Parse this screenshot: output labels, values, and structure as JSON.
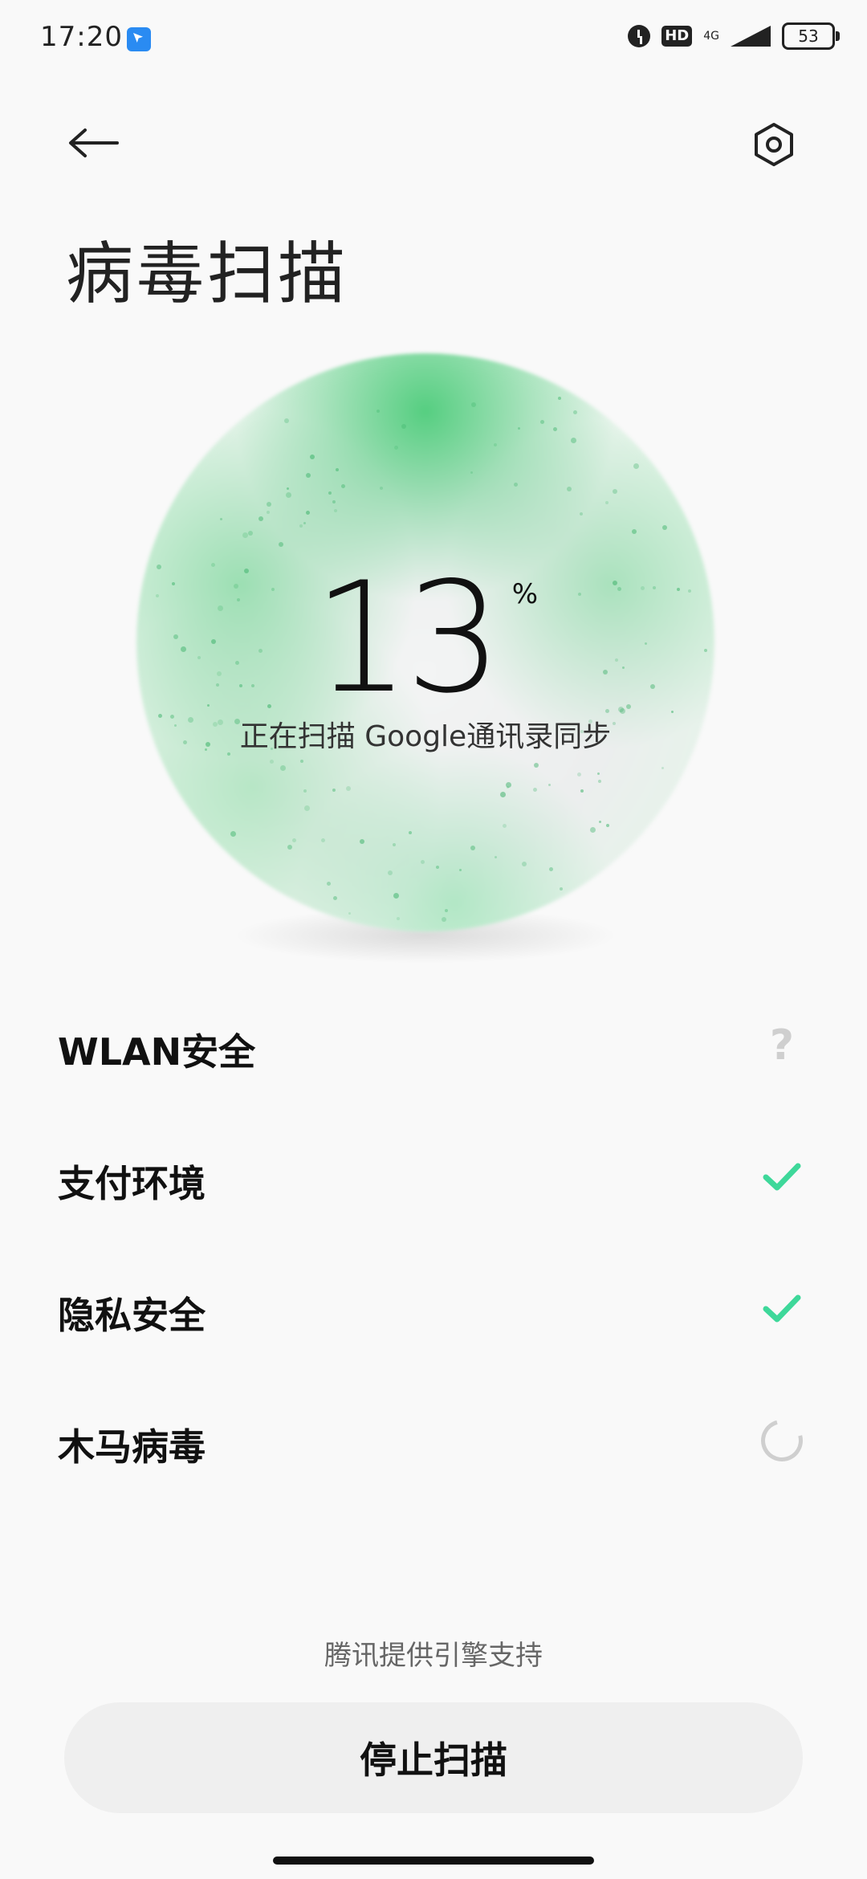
{
  "status_bar": {
    "time": "17:20",
    "hd": "HD",
    "network": "4G",
    "battery": "53"
  },
  "header": {
    "title": "病毒扫描",
    "back_icon": "arrow-left-icon",
    "settings_icon": "settings-hexagon-icon"
  },
  "scan": {
    "progress": "13",
    "progress_unit": "%",
    "status_text": "正在扫描 Google通讯录同步",
    "accent_color": "#3ccc6e"
  },
  "checks": [
    {
      "label": "WLAN安全",
      "status": "unknown",
      "icon": "question-icon"
    },
    {
      "label": "支付环境",
      "status": "passed",
      "icon": "check-icon"
    },
    {
      "label": "隐私安全",
      "status": "passed",
      "icon": "check-icon"
    },
    {
      "label": "木马病毒",
      "status": "scanning",
      "icon": "spinner-icon"
    }
  ],
  "footer": {
    "engine_text": "腾讯提供引擎支持",
    "stop_button": "停止扫描"
  },
  "colors": {
    "check": "#3ed89a",
    "background": "#f9f9f9"
  }
}
